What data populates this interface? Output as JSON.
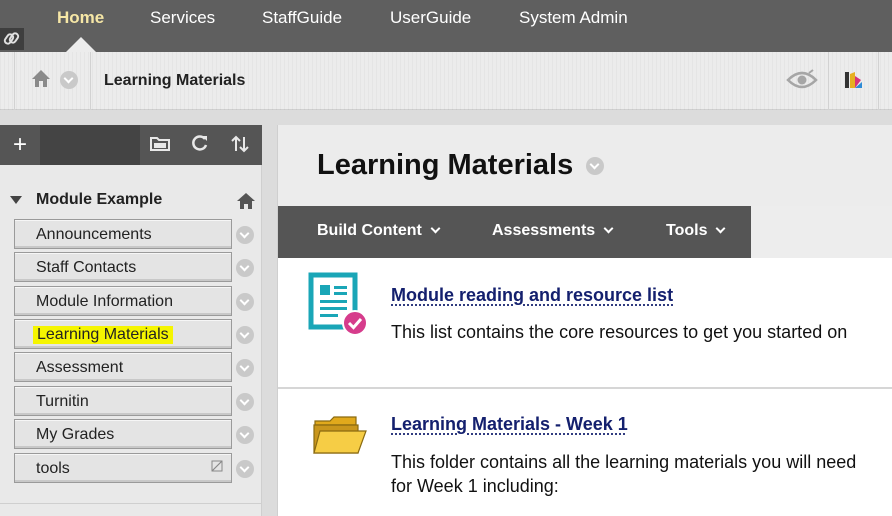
{
  "topnav": {
    "tabs": [
      {
        "label": "Home",
        "active": true
      },
      {
        "label": "Services",
        "active": false
      },
      {
        "label": "StaffGuide",
        "active": false
      },
      {
        "label": "UserGuide",
        "active": false
      },
      {
        "label": "System Admin",
        "active": false
      }
    ]
  },
  "breadcrumb": {
    "current": "Learning Materials"
  },
  "course": {
    "title": "Module Example",
    "menu": [
      {
        "label": "Announcements"
      },
      {
        "label": "Staff Contacts"
      },
      {
        "label": "Module Information"
      },
      {
        "label": "Learning Materials",
        "highlighted": true
      },
      {
        "label": "Assessment"
      },
      {
        "label": "Turnitin"
      },
      {
        "label": "My Grades"
      },
      {
        "label": "tools"
      }
    ]
  },
  "main": {
    "title": "Learning Materials",
    "actions": [
      {
        "label": "Build Content"
      },
      {
        "label": "Assessments"
      },
      {
        "label": "Tools"
      }
    ],
    "items": [
      {
        "title": "Module reading and resource list",
        "desc_lines": [
          "This list contains the core resources to get you started on"
        ]
      },
      {
        "title": "Learning Materials - Week 1",
        "desc_lines": [
          "This folder contains all the learning materials you will need",
          "for Week 1 including:"
        ]
      }
    ]
  },
  "colors": {
    "nav_bg": "#5f5f5f",
    "active_tab": "#f6e7a6",
    "link_text": "#14206e",
    "highlight": "#f5f500",
    "doc_icon_teal": "#1aa6b7",
    "check_pink": "#d63c8c",
    "folder_yellow": "#f2c231"
  },
  "icons": {
    "link": "link-icon",
    "home": "home-icon",
    "eye": "eye-icon",
    "palette": "color-palette-icon",
    "add": "plus-icon",
    "folder": "folder-icon",
    "refresh": "refresh-icon",
    "sort": "sort-icon"
  }
}
